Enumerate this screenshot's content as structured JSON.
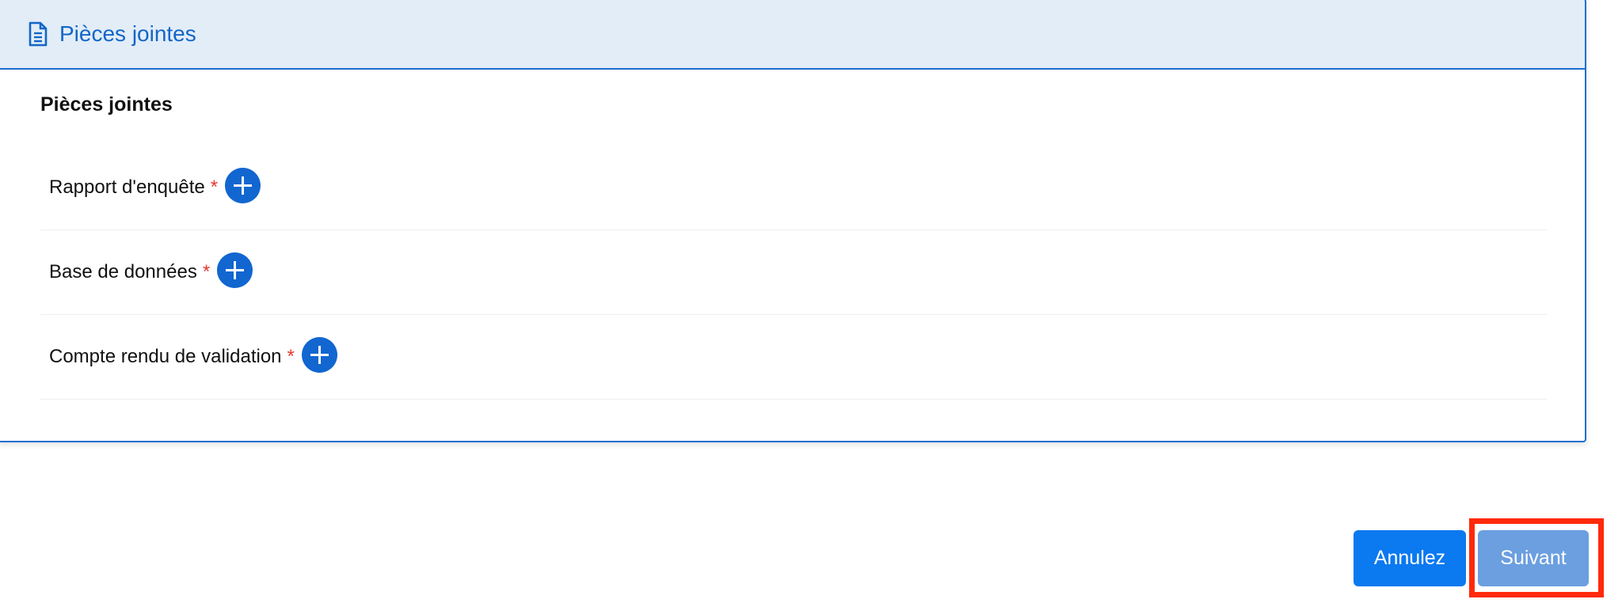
{
  "panel": {
    "header_title": "Pièces jointes",
    "header_icon": "document-icon",
    "section_title": "Pièces jointes"
  },
  "attachments": [
    {
      "label": "Rapport d'enquête",
      "required_mark": "*",
      "add_icon": "plus-icon"
    },
    {
      "label": "Base de données",
      "required_mark": "*",
      "add_icon": "plus-icon"
    },
    {
      "label": "Compte rendu de validation",
      "required_mark": "*",
      "add_icon": "plus-icon"
    }
  ],
  "actions": {
    "cancel_label": "Annulez",
    "next_label": "Suivant"
  },
  "colors": {
    "accent": "#1266d0",
    "header_bg": "#e2edf8",
    "required": "#e53935",
    "cancel_button": "#0b79f0",
    "next_button": "#6b9fe0",
    "highlight": "#ff2a0a"
  }
}
